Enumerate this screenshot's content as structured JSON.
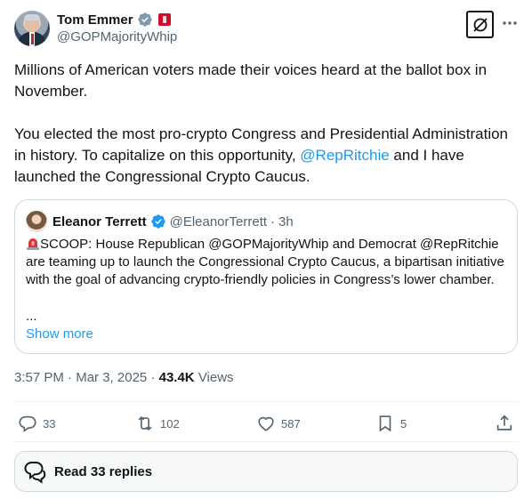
{
  "author": {
    "name": "Tom Emmer",
    "handle": "@GOPMajorityWhip"
  },
  "tweet": {
    "paragraph1": "Millions of American voters made their voices heard at the ballot box in November.",
    "paragraph2_before": "You elected the most pro-crypto Congress and Presidential Administration in history. To capitalize on this opportunity, ",
    "paragraph2_mention": "@RepRitchie",
    "paragraph2_after": " and I have launched the Congressional Crypto Caucus."
  },
  "quote": {
    "name": "Eleanor Terrett",
    "handle": "@EleanorTerrett",
    "separator": "·",
    "time": "3h",
    "text": "SCOOP: House Republican @GOPMajorityWhip and Democrat @RepRitchie are teaming up to launch the Congressional Crypto Caucus, a bipartisan initiative with the goal of advancing crypto-friendly policies in Congress’s lower chamber.",
    "ellipsis": "...",
    "show_more": "Show more"
  },
  "meta": {
    "time": "3:57 PM",
    "date": "Mar 3, 2025",
    "separator": "·",
    "views_count": "43.4K",
    "views_label": "Views"
  },
  "actions": {
    "replies": "33",
    "reposts": "102",
    "likes": "587",
    "bookmarks": "5"
  },
  "read_replies": "Read 33 replies",
  "colors": {
    "accent": "#1d9bf0",
    "secondary_text": "#536471",
    "border": "#cfd9de",
    "verified_gray": "#829aab"
  },
  "icons": [
    "verified-gray-icon",
    "flag-badge-icon",
    "grok-icon",
    "more-icon",
    "verified-blue-icon",
    "siren-icon",
    "reply-icon",
    "repost-icon",
    "like-icon",
    "bookmark-icon",
    "share-icon",
    "speech-bubbles-icon"
  ]
}
